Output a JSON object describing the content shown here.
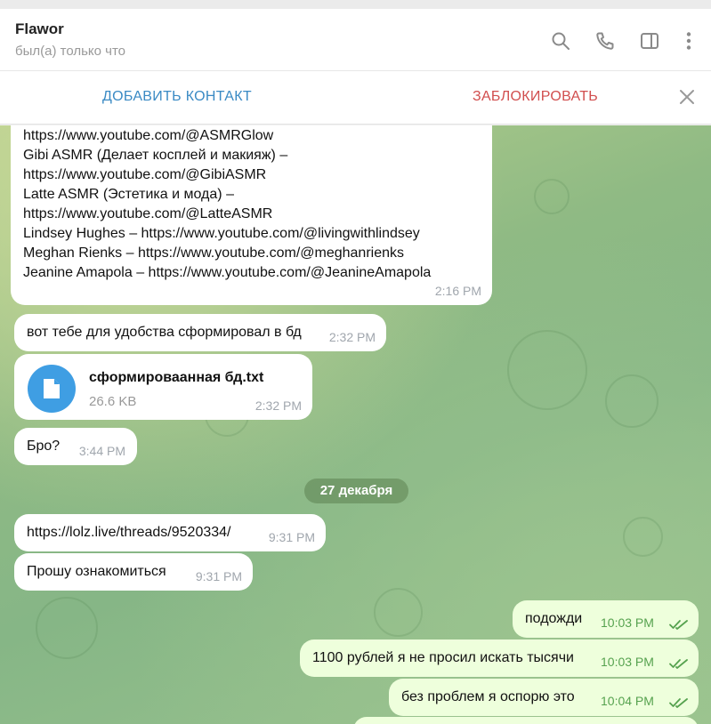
{
  "header": {
    "name": "Flawor",
    "status": "был(а) только что"
  },
  "actions": {
    "add_contact": "ДОБАВИТЬ КОНТАКТ",
    "block": "ЗАБЛОКИРОВАТЬ"
  },
  "messages": [
    {
      "id": "m1",
      "direction": "in",
      "lines": [
        "https://www.youtube.com/@ASMRGlow",
        "Gibi ASMR (Делает косплей и макияж) –",
        "https://www.youtube.com/@GibiASMR",
        "Latte ASMR (Эстетика и мода) –",
        "https://www.youtube.com/@LatteASMR",
        "Lindsey Hughes – https://www.youtube.com/@livingwithlindsey",
        "Meghan Rienks – https://www.youtube.com/@meghanrienks",
        "Jeanine Amapola – https://www.youtube.com/@JeanineAmapola"
      ],
      "time": "2:16 PM"
    },
    {
      "id": "m2",
      "direction": "in",
      "text": "вот тебе для удобства сформировал в бд",
      "time": "2:32 PM"
    },
    {
      "id": "m3",
      "direction": "in",
      "file_name": "сформироваанная бд.txt",
      "file_size": "26.6 KB",
      "time": "2:32 PM"
    },
    {
      "id": "m4",
      "direction": "in",
      "text": "Бро?",
      "time": "3:44 PM"
    },
    {
      "id": "m5",
      "direction": "in",
      "text": "https://lolz.live/threads/9520334/",
      "time": "9:31 PM"
    },
    {
      "id": "m6",
      "direction": "in",
      "text": "Прошу ознакомиться",
      "time": "9:31 PM"
    },
    {
      "id": "m7",
      "direction": "out",
      "text": "подожди",
      "time": "10:03 PM",
      "read": true
    },
    {
      "id": "m8",
      "direction": "out",
      "text": "1100 рублей я не просил искать тысячи",
      "time": "10:03 PM",
      "read": true
    },
    {
      "id": "m9",
      "direction": "out",
      "text": "без проблем я оспорю это",
      "time": "10:04 PM",
      "read": true
    }
  ],
  "date_separator": "27 декабря",
  "icons": [
    "search-icon",
    "phone-icon",
    "sidebar-toggle-icon",
    "more-vertical-icon",
    "close-icon",
    "file-icon",
    "double-check-icon"
  ],
  "colors": {
    "accent": "#3a8ac4",
    "danger": "#d14e4e",
    "outgoing_bubble": "#eeffdc",
    "read_checks": "#56a24f",
    "file_icon_bg": "#3f9ee3"
  }
}
